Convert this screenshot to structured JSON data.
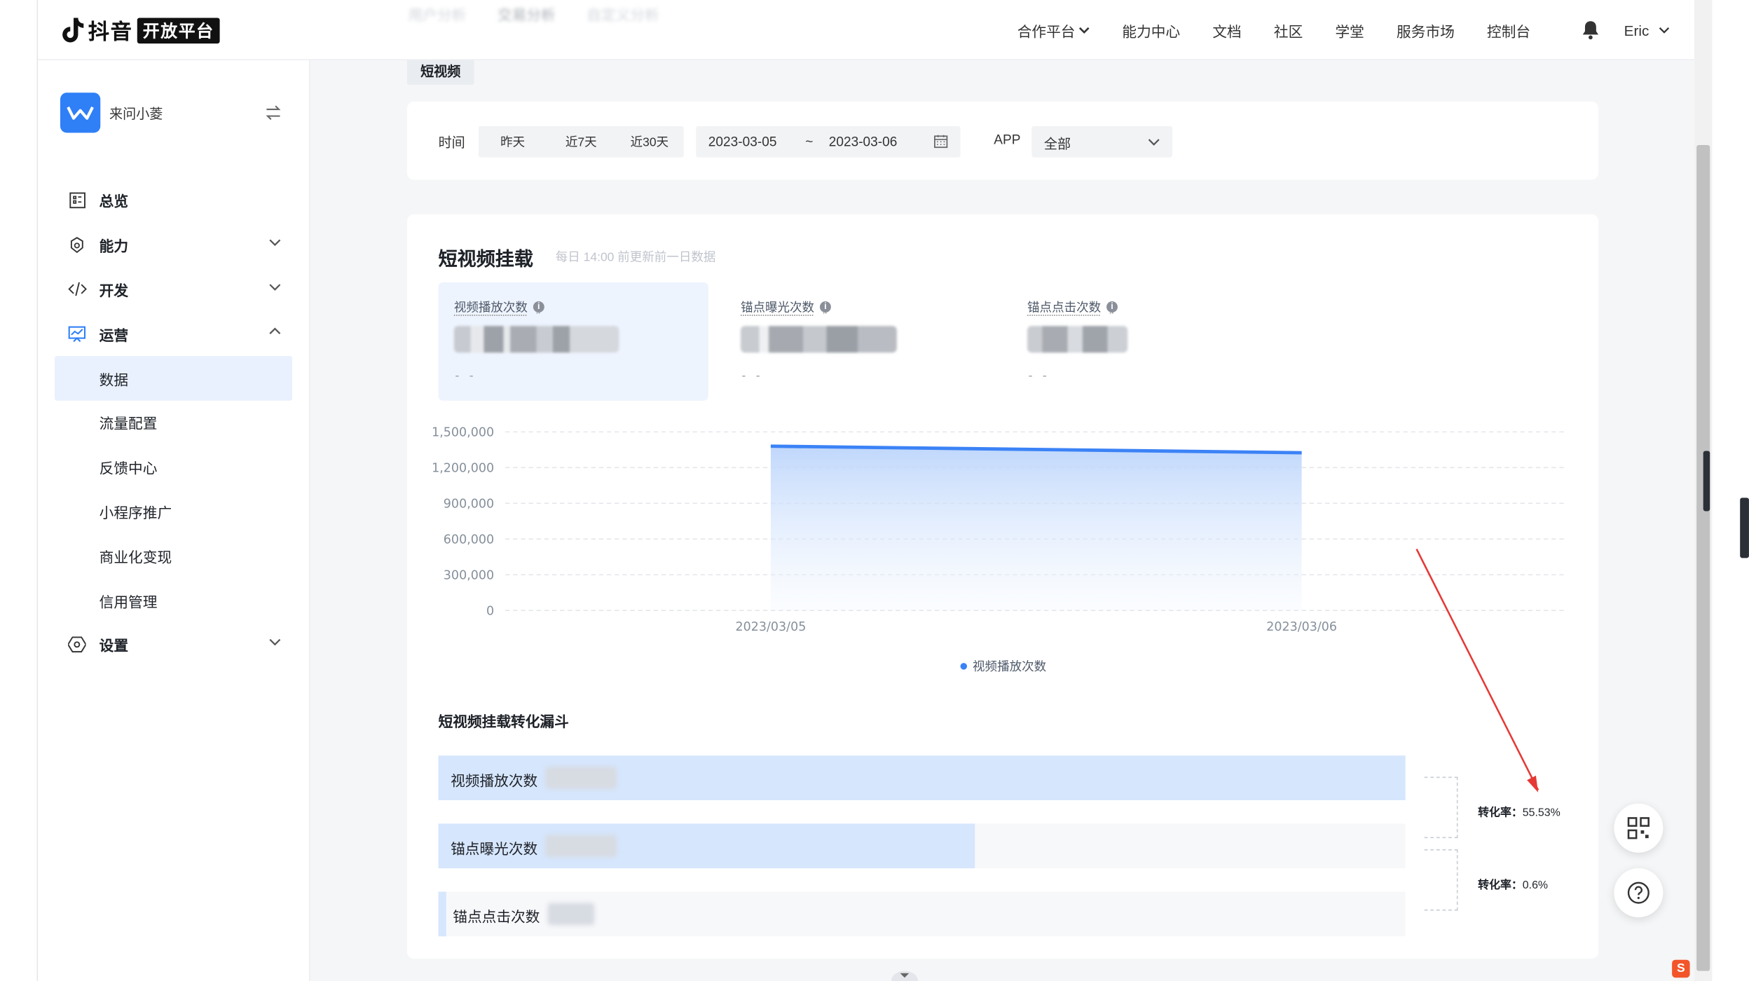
{
  "brand": {
    "name": "抖音",
    "badge": "开放平台"
  },
  "nav": {
    "items": [
      "合作平台",
      "能力中心",
      "文档",
      "社区",
      "学堂",
      "服务市场",
      "控制台"
    ],
    "user": "Eric"
  },
  "ghost_tabs": [
    "用户分析",
    "交易分析",
    "自定义分析"
  ],
  "app": {
    "name": "来问小菱"
  },
  "menu": {
    "overview": "总览",
    "ability": "能力",
    "develop": "开发",
    "operate": "运营",
    "data": "数据",
    "traffic": "流量配置",
    "feedback": "反馈中心",
    "promotion": "小程序推广",
    "monetize": "商业化变现",
    "credit": "信用管理",
    "settings": "设置"
  },
  "subtab": "短视频",
  "filter": {
    "time_label": "时间",
    "ranges": [
      "昨天",
      "近7天",
      "近30天"
    ],
    "start_date": "2023-03-05",
    "separator": "~",
    "end_date": "2023-03-06",
    "app_label": "APP",
    "app_value": "全部"
  },
  "card": {
    "title": "短视频挂载",
    "subtitle": "每日 14:00 前更新前一日数据",
    "metrics": [
      {
        "label": "视频播放次数",
        "delta": "- -"
      },
      {
        "label": "锚点曝光次数",
        "delta": "- -"
      },
      {
        "label": "锚点点击次数",
        "delta": "- -"
      }
    ]
  },
  "chart_data": {
    "type": "area",
    "x": [
      "2023/03/05",
      "2023/03/06"
    ],
    "series": [
      {
        "name": "视频播放次数",
        "values": [
          1380000,
          1325000
        ]
      }
    ],
    "ylim": [
      0,
      1500000
    ],
    "yticks": [
      "1,500,000",
      "1,200,000",
      "900,000",
      "600,000",
      "300,000",
      "0"
    ],
    "ytick_values": [
      1500000,
      1200000,
      900000,
      600000,
      300000,
      0
    ],
    "grid": true,
    "legend_position": "bottom",
    "colors": {
      "line": "#3b82f6",
      "area": "#d6e6fd"
    }
  },
  "funnel": {
    "title": "短视频挂载转化漏斗",
    "bars": [
      {
        "label": "视频播放次数",
        "fraction": 1.0
      },
      {
        "label": "锚点曝光次数",
        "fraction": 0.5553
      },
      {
        "label": "锚点点击次数",
        "fraction": 0.006
      }
    ],
    "conversions": [
      {
        "label": "转化率：",
        "value": "55.53%"
      },
      {
        "label": "转化率：",
        "value": "0.6%"
      }
    ]
  },
  "colors": {
    "accent": "#2f7ff7",
    "annotation": "#e53935"
  }
}
